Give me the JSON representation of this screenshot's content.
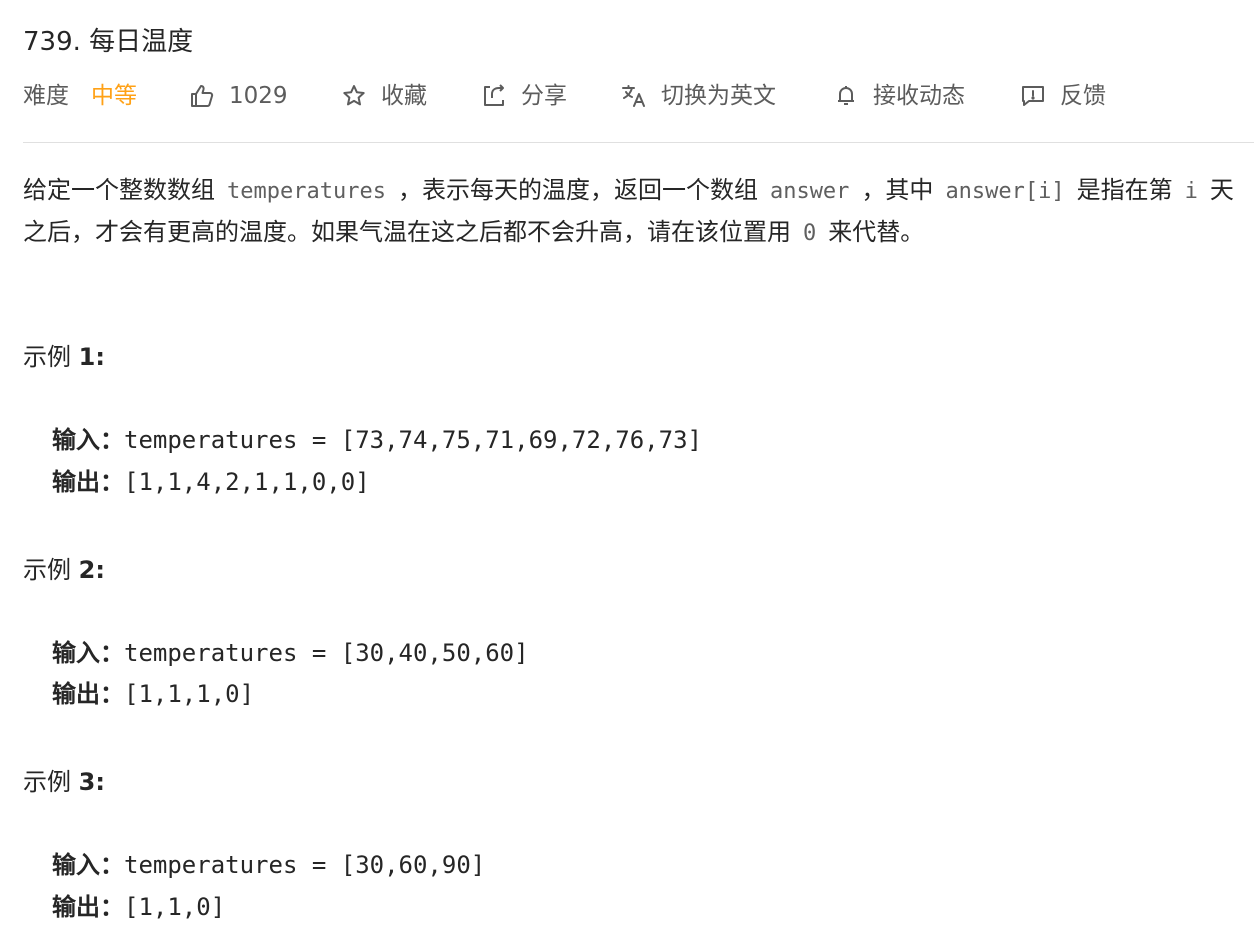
{
  "problem": {
    "title": "739. 每日温度"
  },
  "toolbar": {
    "difficulty_label": "难度",
    "difficulty_value": "中等",
    "difficulty_color": "#ffa116",
    "likes": "1029",
    "favorite_label": "收藏",
    "share_label": "分享",
    "translate_label": "切换为英文",
    "notify_label": "接收动态",
    "feedback_label": "反馈",
    "icons": [
      "thumbs-up-icon",
      "star-icon",
      "share-icon",
      "translate-icon",
      "bell-icon",
      "feedback-icon"
    ]
  },
  "description": {
    "p1_a": "给定一个整数数组",
    "code1": "temperatures",
    "p1_b": "，表示每天的温度，返回一个数组",
    "code2": "answer",
    "p1_c": "，其中",
    "code3": "answer[i]",
    "p1_d": "是指在第",
    "code4": "i",
    "p1_e": "天之后，才会有更高的温度。如果气温在这之后都不会升高，请在该位置用",
    "code5": "0",
    "p1_f": "来代替。"
  },
  "examples": [
    {
      "title_prefix": "示例",
      "title_num": "1:",
      "input_label": "输入：",
      "input_value": "temperatures = [73,74,75,71,69,72,76,73]",
      "output_label": "输出：",
      "output_value": "[1,1,4,2,1,1,0,0]"
    },
    {
      "title_prefix": "示例",
      "title_num": "2:",
      "input_label": "输入：",
      "input_value": "temperatures = [30,40,50,60]",
      "output_label": "输出：",
      "output_value": "[1,1,1,0]"
    },
    {
      "title_prefix": "示例",
      "title_num": "3:",
      "input_label": "输入：",
      "input_value": "temperatures = [30,60,90]",
      "output_label": "输出：",
      "output_value": "[1,1,0]"
    }
  ]
}
